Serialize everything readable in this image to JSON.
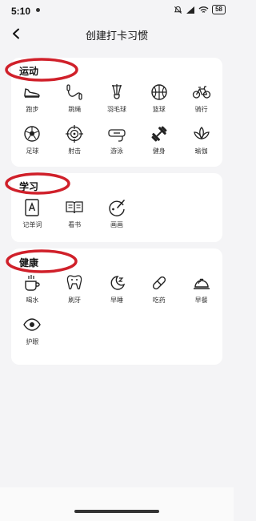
{
  "status_bar": {
    "time": "5:10",
    "battery": "58"
  },
  "header": {
    "title": "创建打卡习惯"
  },
  "sections": [
    {
      "title": "运动",
      "items": [
        {
          "label": "跑步",
          "icon": "shoe-icon"
        },
        {
          "label": "跳绳",
          "icon": "jump-rope-icon"
        },
        {
          "label": "羽毛球",
          "icon": "shuttlecock-icon"
        },
        {
          "label": "篮球",
          "icon": "basketball-icon"
        },
        {
          "label": "骑行",
          "icon": "bicycle-icon"
        },
        {
          "label": "足球",
          "icon": "soccer-ball-icon"
        },
        {
          "label": "射击",
          "icon": "target-icon"
        },
        {
          "label": "游泳",
          "icon": "goggles-icon"
        },
        {
          "label": "健身",
          "icon": "dumbbell-icon"
        },
        {
          "label": "瑜伽",
          "icon": "lotus-icon"
        }
      ]
    },
    {
      "title": "学习",
      "items": [
        {
          "label": "记单词",
          "icon": "letter-a-icon"
        },
        {
          "label": "看书",
          "icon": "book-icon"
        },
        {
          "label": "画画",
          "icon": "palette-icon"
        }
      ]
    },
    {
      "title": "健康",
      "items": [
        {
          "label": "喝水",
          "icon": "cup-icon"
        },
        {
          "label": "刷牙",
          "icon": "tooth-icon"
        },
        {
          "label": "早睡",
          "icon": "moon-icon"
        },
        {
          "label": "吃药",
          "icon": "pill-icon"
        },
        {
          "label": "早餐",
          "icon": "cloche-icon"
        },
        {
          "label": "护眼",
          "icon": "eye-icon"
        }
      ]
    }
  ],
  "colors": {
    "annotation": "#d0202a",
    "card": "#ffffff",
    "background": "#f4f4f6"
  }
}
